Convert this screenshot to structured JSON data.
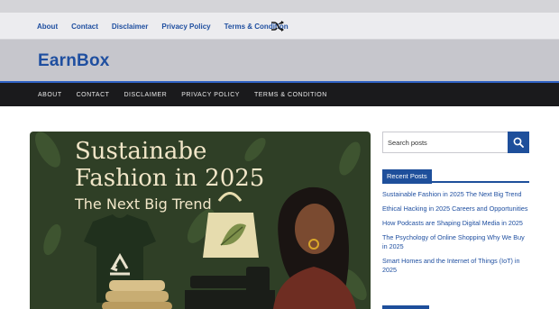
{
  "topbar": {
    "links": [
      "About",
      "Contact",
      "Disclaimer",
      "Privacy Policy",
      "Terms & Condition"
    ],
    "shuffle_icon": "shuffle-icon"
  },
  "header": {
    "site_title": "EarnBox",
    "accent": "#2f62c4"
  },
  "mainnav": {
    "items": [
      "ABOUT",
      "CONTACT",
      "DISCLAIMER",
      "PRIVACY POLICY",
      "TERMS & CONDITION"
    ]
  },
  "hero": {
    "title_line1": "Sustainabe",
    "title_line2": "Fashion in 2025",
    "subtitle": "The Next Big Trend",
    "background": "#2f3f26",
    "text_color": "#f1e6c8"
  },
  "sidebar": {
    "search": {
      "placeholder": "Search posts",
      "icon": "search-icon"
    },
    "recent_heading": "Recent Posts",
    "recent_posts": [
      "Sustainable Fashion in 2025 The Next Big Trend",
      "Ethical Hacking in 2025 Careers and Opportunities",
      "How Podcasts are Shaping Digital Media in 2025",
      "The Psychology of Online Shopping Why We Buy in 2025",
      "Smart Homes and the Internet of Things (IoT) in 2025"
    ],
    "brand_color": "#1e4f9b"
  }
}
